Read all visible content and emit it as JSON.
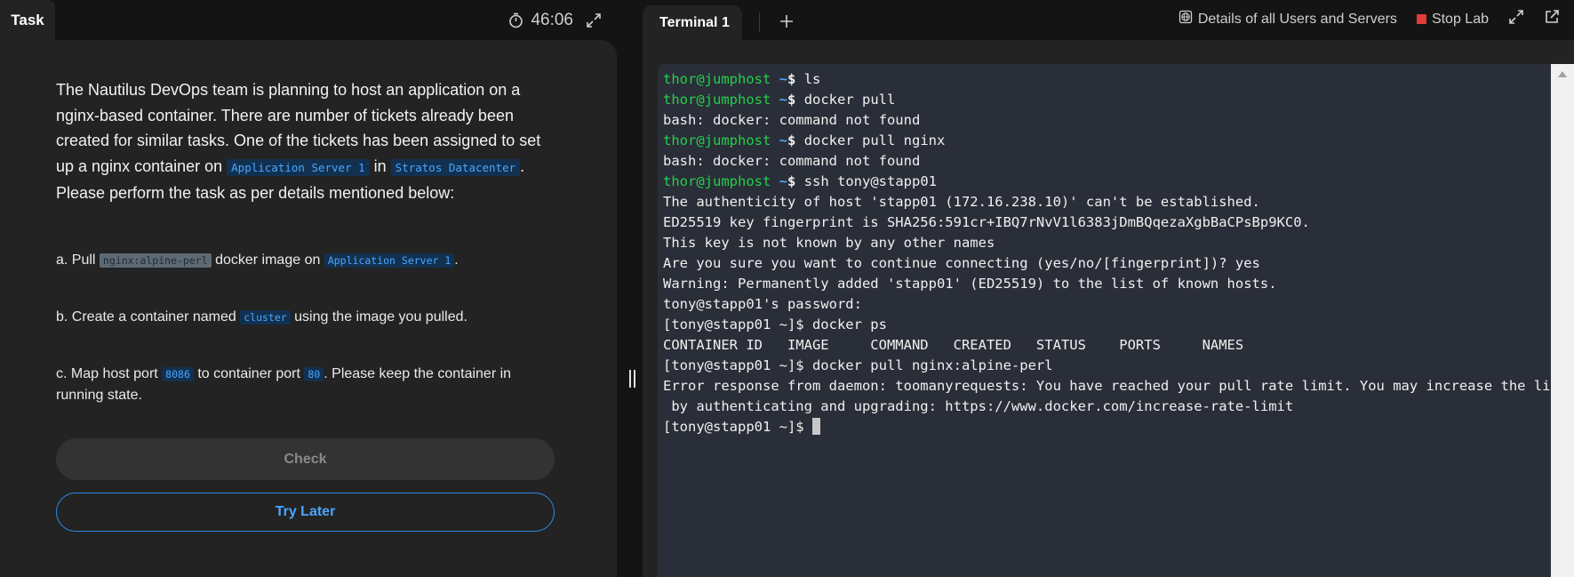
{
  "left": {
    "tab_label": "Task",
    "timer": "46:06",
    "desc": {
      "p1": "The Nautilus DevOps team is planning to host an application on a nginx-based container. There are number of tickets already been created for similar tasks. One of the tickets has been assigned to set up a nginx container on ",
      "server": "Application Server 1",
      "p2": " in ",
      "datacenter": "Stratos Datacenter",
      "p3": ". Please perform the task as per details mentioned below:"
    },
    "step_a": {
      "pre": "a. Pull ",
      "image": "nginx:alpine-perl",
      "mid": " docker image on ",
      "server": "Application Server 1",
      "post": "."
    },
    "step_b": {
      "pre": "b. Create a container named ",
      "name": "cluster",
      "post": " using the image you pulled."
    },
    "step_c": {
      "pre": "c. Map host port ",
      "host_port": "8086",
      "mid": " to container port ",
      "container_port": "80",
      "post": ". Please keep the container in running state."
    },
    "check_label": "Check",
    "try_later_label": "Try Later"
  },
  "right": {
    "tab_label": "Terminal 1",
    "details_label": "Details of all Users and Servers",
    "stop_label": "Stop Lab",
    "lines": [
      {
        "user": "thor@jumphost",
        "path": "~",
        "sym": "$",
        "cmd": " ls"
      },
      {
        "user": "thor@jumphost",
        "path": "~",
        "sym": "$",
        "cmd": " docker pull"
      },
      {
        "text": "bash: docker: command not found"
      },
      {
        "user": "thor@jumphost",
        "path": "~",
        "sym": "$",
        "cmd": " docker pull nginx"
      },
      {
        "text": "bash: docker: command not found"
      },
      {
        "user": "thor@jumphost",
        "path": "~",
        "sym": "$",
        "cmd": " ssh tony@stapp01"
      },
      {
        "text": "The authenticity of host 'stapp01 (172.16.238.10)' can't be established."
      },
      {
        "text": "ED25519 key fingerprint is SHA256:591cr+IBQ7rNvV1l6383jDmBQqezaXgbBaCPsBp9KC0."
      },
      {
        "text": "This key is not known by any other names"
      },
      {
        "text": "Are you sure you want to continue connecting (yes/no/[fingerprint])? yes"
      },
      {
        "text": "Warning: Permanently added 'stapp01' (ED25519) to the list of known hosts."
      },
      {
        "text": "tony@stapp01's password:"
      },
      {
        "text": "[tony@stapp01 ~]$ docker ps"
      },
      {
        "text": "CONTAINER ID   IMAGE     COMMAND   CREATED   STATUS    PORTS     NAMES"
      },
      {
        "text": "[tony@stapp01 ~]$ docker pull nginx:alpine-perl"
      },
      {
        "text": "Error response from daemon: toomanyrequests: You have reached your pull rate limit. You may increase the limit"
      },
      {
        "text": " by authenticating and upgrading: https://www.docker.com/increase-rate-limit"
      },
      {
        "text": "[tony@stapp01 ~]$ ",
        "cursor": true
      }
    ]
  },
  "colors": {
    "accent": "#4aa6ff",
    "prompt_user": "#22d04a",
    "stop": "#e23b3b"
  },
  "icons": [
    "stopwatch-icon",
    "expand-icon",
    "plus-icon",
    "globe-icon",
    "stop-icon",
    "external-link-icon",
    "scroll-up-arrow-icon"
  ]
}
